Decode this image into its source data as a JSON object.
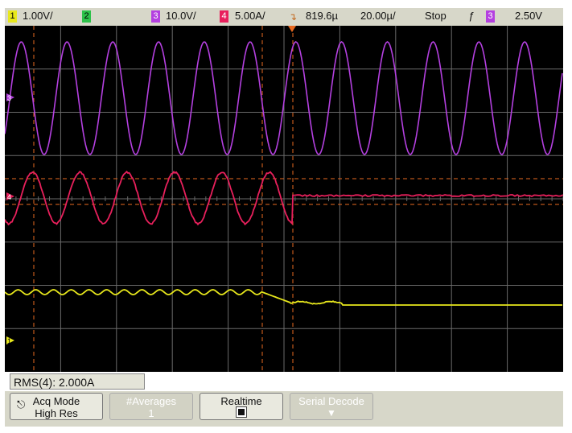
{
  "status_bar": {
    "ch1_number": "1",
    "ch1_scale": "1.00V/",
    "ch2_number": "2",
    "ch3_number": "3",
    "ch3_scale": "10.0V/",
    "ch4_number": "4",
    "ch4_scale": "5.00A/",
    "trigger_position": "819.6µ",
    "time_scale": "20.00µ/",
    "run_state": "Stop",
    "trigger_slope": "ƒ",
    "trigger_source": "3",
    "trigger_level": "2.50V"
  },
  "measurement": {
    "label": "RMS(4): 2.000A"
  },
  "softkeys": [
    {
      "title": "Acq Mode",
      "value": "High Res",
      "enabled": true
    },
    {
      "title": "#Averages",
      "value": "1",
      "enabled": false
    },
    {
      "title": "Realtime",
      "value": "",
      "enabled": true
    },
    {
      "title": "Serial Decode",
      "value": "",
      "enabled": false
    }
  ],
  "markers": {
    "ch3": "3",
    "ch4": "4",
    "ch1": "1",
    "trigger": "T"
  },
  "colors": {
    "ch1": "#e8e81c",
    "ch3": "#b440e0",
    "ch4": "#e8205c",
    "trigger": "#e86a20",
    "grid": "#6a6a6a"
  },
  "waveforms": {
    "ch3_cycles_visible": 12,
    "ch4_cycles_before_trigger": 6,
    "ch4_rms_current_A": 2.0
  }
}
